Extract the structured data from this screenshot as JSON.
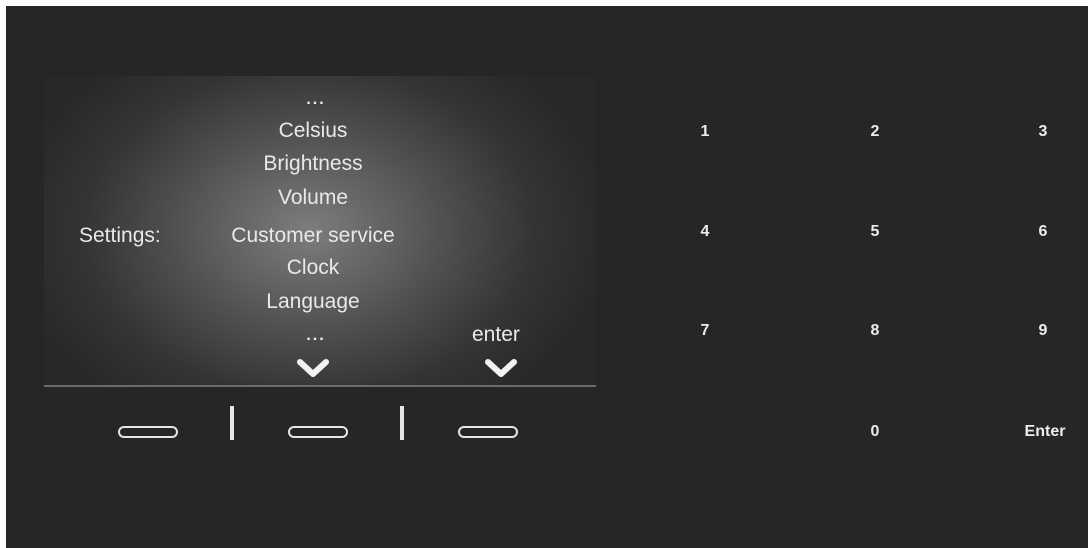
{
  "screen": {
    "top_ellipsis": "...",
    "bottom_ellipsis": "...",
    "settings_label": "Settings:",
    "menu_items": [
      "Celsius",
      "Brightness",
      "Volume",
      "Customer service",
      "Clock",
      "Language"
    ],
    "enter_label": "enter",
    "scroll_icon": "chevron-down-icon",
    "enter_icon": "chevron-down-icon"
  },
  "softkeys": [
    "left-softkey",
    "middle-softkey",
    "right-softkey"
  ],
  "keypad": {
    "keys": [
      "1",
      "2",
      "3",
      "4",
      "5",
      "6",
      "7",
      "8",
      "9",
      "0",
      "Enter"
    ]
  },
  "colors": {
    "panel": "#262626",
    "text": "#e9e9e9"
  }
}
